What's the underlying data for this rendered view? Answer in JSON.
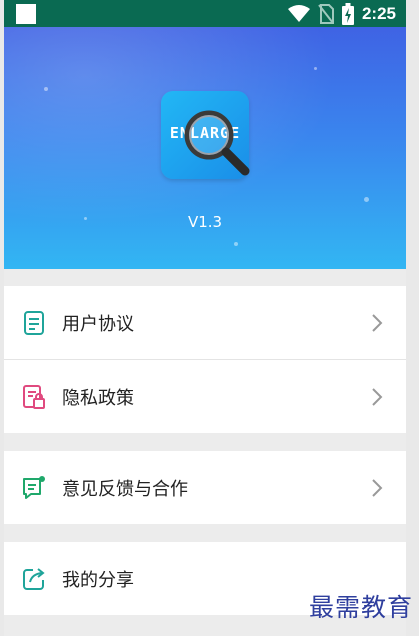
{
  "status_bar": {
    "time": "2:25",
    "icons": [
      "notification-square-icon",
      "wifi-icon",
      "no-sim-icon",
      "battery-charging-icon"
    ]
  },
  "header": {
    "app_icon": "app-logo-magnifier-icon",
    "version": "V1.3"
  },
  "menu": {
    "items": [
      {
        "label": "用户协议",
        "icon": "document-icon"
      },
      {
        "label": "隐私政策",
        "icon": "privacy-lock-icon"
      },
      {
        "label": "意见反馈与合作",
        "icon": "feedback-message-icon"
      },
      {
        "label": "我的分享",
        "icon": "share-icon"
      }
    ]
  },
  "watermark": "最需教育",
  "colors": {
    "status_bar": "#0a6a52",
    "hero_top": "#3f63e4",
    "hero_bottom": "#32b6f3",
    "icon_teal": "#1fa49a",
    "icon_pink": "#e04a7f",
    "icon_green": "#1fa86b"
  }
}
